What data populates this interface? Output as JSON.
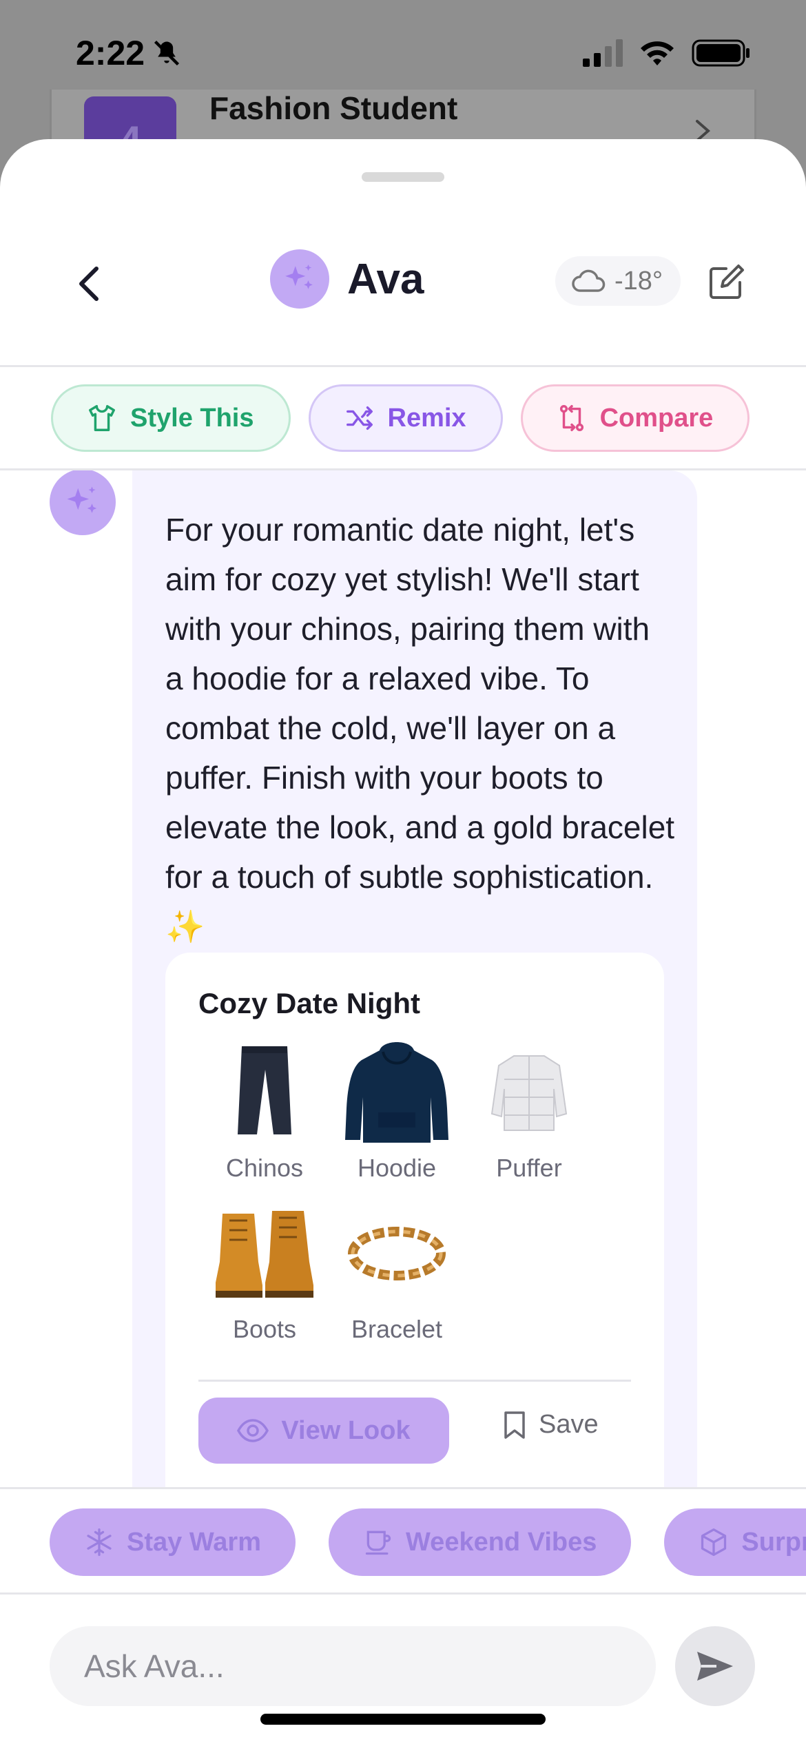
{
  "status_bar": {
    "time": "2:22"
  },
  "background_app": {
    "badge": "4",
    "title": "Fashion Student"
  },
  "header": {
    "name": "Ava",
    "weather": "-18°"
  },
  "actions": [
    {
      "label": "Style This",
      "icon": "shirt-icon"
    },
    {
      "label": "Remix",
      "icon": "shuffle-icon"
    },
    {
      "label": "Compare",
      "icon": "compare-icon"
    }
  ],
  "message": {
    "text": "For your romantic date night, let's aim for cozy yet stylish! We'll start with your chinos, pairing them with a hoodie for a relaxed vibe. To combat the cold, we'll layer on a puffer. Finish with your boots to elevate the look, and a gold bracelet for a touch of subtle sophistication. ✨"
  },
  "look": {
    "title": "Cozy Date Night",
    "items": [
      {
        "label": "Chinos",
        "icon": "chinos-image"
      },
      {
        "label": "Hoodie",
        "icon": "hoodie-image"
      },
      {
        "label": "Puffer",
        "icon": "puffer-image"
      },
      {
        "label": "Boots",
        "icon": "boots-image"
      },
      {
        "label": "Bracelet",
        "icon": "bracelet-image"
      }
    ],
    "view_label": "View Look",
    "save_label": "Save"
  },
  "suggestions": [
    {
      "label": "Stay Warm",
      "icon": "snowflake-icon"
    },
    {
      "label": "Weekend Vibes",
      "icon": "coffee-icon"
    },
    {
      "label": "Surpri",
      "icon": "dice-icon"
    }
  ],
  "composer": {
    "placeholder": "Ask Ava..."
  },
  "colors": {
    "accent": "#c4a8f2",
    "accent_text": "#9b7fe0",
    "bubble": "#f5f3ff"
  }
}
